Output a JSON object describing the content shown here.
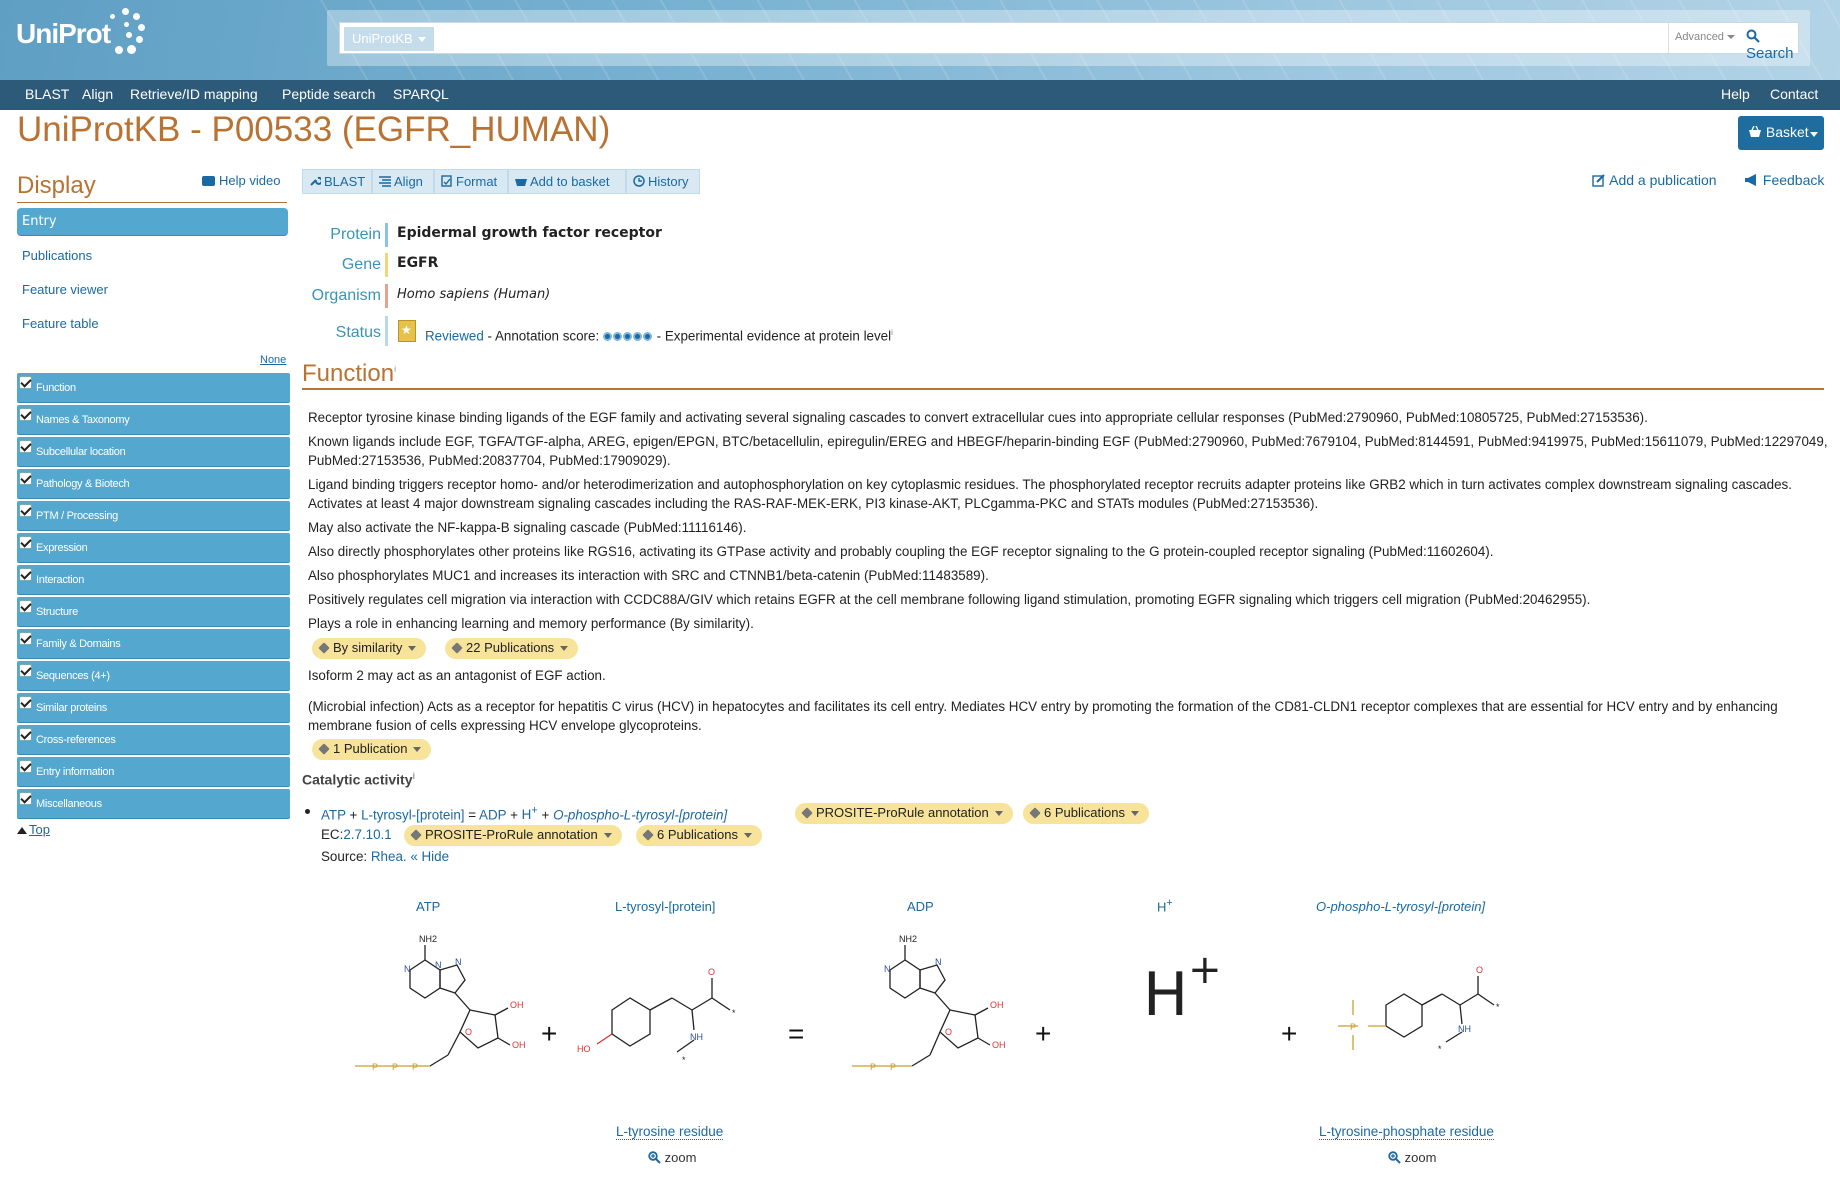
{
  "header": {
    "logo_text": "UniProt",
    "db_select": "UniProtKB",
    "search_placeholder": "",
    "advanced_label": "Advanced",
    "search_label": "Search",
    "nav_left": [
      "BLAST",
      "Align",
      "Retrieve/ID mapping",
      "Peptide search",
      "SPARQL"
    ],
    "nav_right": [
      "Help",
      "Contact"
    ]
  },
  "title": "UniProtKB - P00533 (EGFR_HUMAN)",
  "basket_label": "Basket",
  "sidebar": {
    "title": "Display",
    "help_video": "Help video",
    "views": [
      "Entry",
      "Publications",
      "Feature viewer",
      "Feature table"
    ],
    "none_label": "None",
    "sections": [
      "Function",
      "Names & Taxonomy",
      "Subcellular location",
      "Pathology & Biotech",
      "PTM / Processing",
      "Expression",
      "Interaction",
      "Structure",
      "Family & Domains",
      "Sequences (4+)",
      "Similar proteins",
      "Cross-references",
      "Entry information",
      "Miscellaneous"
    ],
    "top_label": "Top"
  },
  "toolbar": {
    "buttons": [
      "BLAST",
      "Align",
      "Format",
      "Add to basket",
      "History"
    ],
    "add_publication": "Add a publication",
    "feedback": "Feedback"
  },
  "names": {
    "protein_label": "Protein",
    "protein": "Epidermal growth factor receptor",
    "gene_label": "Gene",
    "gene": "EGFR",
    "organism_label": "Organism",
    "organism": "Homo sapiens (Human)",
    "status_label": "Status",
    "reviewed": "Reviewed",
    "annotation_text": " - Annotation score: ",
    "evidence_text": " - Experimental evidence at protein level",
    "info_mark": "i"
  },
  "function": {
    "title": "Function",
    "paragraphs": [
      "Receptor tyrosine kinase binding ligands of the EGF family and activating several signaling cascades to convert extracellular cues into appropriate cellular responses (PubMed:2790960, PubMed:10805725, PubMed:27153536).",
      "Known ligands include EGF, TGFA/TGF-alpha, AREG, epigen/EPGN, BTC/betacellulin, epiregulin/EREG and HBEGF/heparin-binding EGF (PubMed:2790960, PubMed:7679104, PubMed:8144591, PubMed:9419975, PubMed:15611079, PubMed:12297049, PubMed:27153536, PubMed:20837704, PubMed:17909029).",
      "Ligand binding triggers receptor homo- and/or heterodimerization and autophosphorylation on key cytoplasmic residues. The phosphorylated receptor recruits adapter proteins like GRB2 which in turn activates complex downstream signaling cascades. Activates at least 4 major downstream signaling cascades including the RAS-RAF-MEK-ERK, PI3 kinase-AKT, PLCgamma-PKC and STATs modules (PubMed:27153536).",
      "May also activate the NF-kappa-B signaling cascade (PubMed:11116146).",
      "Also directly phosphorylates other proteins like RGS16, activating its GTPase activity and probably coupling the EGF receptor signaling to the G protein-coupled receptor signaling (PubMed:11602604).",
      "Also phosphorylates MUC1 and increases its interaction with SRC and CTNNB1/beta-catenin (PubMed:11483589).",
      "Positively regulates cell migration via interaction with CCDC88A/GIV which retains EGFR at the cell membrane following ligand stimulation, promoting EGFR signaling which triggers cell migration (PubMed:20462955).",
      "Plays a role in enhancing learning and memory performance (By similarity).",
      "Isoform 2 may act as an antagonist of EGF action.",
      "(Microbial infection) Acts as a receptor for hepatitis C virus (HCV) in hepatocytes and facilitates its cell entry. Mediates HCV entry by promoting the formation of the CD81-CLDN1 receptor complexes that are essential for HCV entry and by enhancing membrane fusion of cells expressing HCV envelope glycoproteins."
    ],
    "pill_similarity": "By similarity",
    "pill_22": "22 Publications",
    "pill_1": "1 Publication"
  },
  "catalytic": {
    "title": "Catalytic activity",
    "reaction": [
      "ATP",
      " + ",
      "L-tyrosyl-[protein]",
      " = ",
      "ADP",
      " + ",
      "H",
      "+",
      " + ",
      "O-phospho-L-tyrosyl-[protein]"
    ],
    "prosite": "PROSITE-ProRule annotation",
    "six_pubs": "6 Publications",
    "ec_label": "EC:",
    "ec": "2.7.10.1",
    "source_label": "Source: ",
    "source": "Rhea.",
    "hide": "« Hide"
  },
  "structures": {
    "atp": "ATP",
    "tyrosyl": "L-tyrosyl-[protein]",
    "adp": "ADP",
    "h": "H",
    "h_sup": "+",
    "phospho": "O-phospho-L-tyrosyl-[protein]",
    "tyr_residue": "L-tyrosine residue",
    "tyrp_residue": "L-tyrosine-phosphate residue",
    "zoom": "zoom",
    "plus": "+",
    "equals": "=",
    "nh2": "NH2",
    "oh": "OH",
    "ho": "HO",
    "nh": "NH",
    "o": "O",
    "n": "N",
    "p": "P",
    "star": "*"
  },
  "colors": {
    "accent": "#b87333",
    "link": "#1a69a3",
    "sidebar": "#54a8cf",
    "pill": "#f7e39a",
    "nav": "#2d5a78"
  }
}
